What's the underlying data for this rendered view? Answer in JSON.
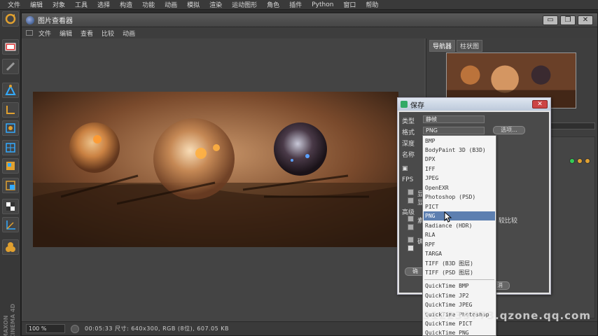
{
  "main_menu": [
    "文件",
    "编辑",
    "对象",
    "工具",
    "选择",
    "构造",
    "功能",
    "动画",
    "模拟",
    "渲染",
    "运动图形",
    "角色",
    "插件",
    "Python",
    "窗口",
    "帮助"
  ],
  "viewer": {
    "title": "图片查看器",
    "menu": [
      "文件",
      "编辑",
      "查看",
      "比较",
      "动画"
    ],
    "nav_tabs": [
      "导航器",
      "柱状图"
    ],
    "zoom": "100 %",
    "status": "00:05:33  尺寸: 640x300, RGB (8位), 607.05 KB",
    "controls": {
      "minimize": "▭",
      "restore": "❐",
      "close": "✕"
    }
  },
  "save_dialog": {
    "title": "保存",
    "type_label": "类型",
    "type_value": "静帧",
    "format_label": "格式",
    "format_value": "PNG",
    "options_button": "选项...",
    "depth_label": "深度",
    "name_label": "名称",
    "fps_label": "FPS",
    "advanced_label": "高级",
    "compare_label": "较比较",
    "partial_labels": [
      "显",
      "显",
      "素",
      "确",
      "消"
    ],
    "close": "✕"
  },
  "format_dropdown": {
    "items": [
      "BMP",
      "BodyPaint 3D (B3D)",
      "DPX",
      "IFF",
      "JPEG",
      "OpenEXR",
      "Photoshop (PSD)",
      "PICT",
      "PNG",
      "Radiance (HDR)",
      "RLA",
      "RPF",
      "TARGA",
      "TIFF (B3D 图层)",
      "TIFF (PSD 图层)"
    ],
    "quicktime_items": [
      "QuickTime BMP",
      "QuickTime JP2",
      "QuickTime JPEG",
      "QuickTime Photoshop",
      "QuickTime PICT",
      "QuickTime PNG"
    ],
    "selected": "PNG"
  },
  "cinema_logo": [
    "MAXON",
    "CINEMA 4D"
  ],
  "watermark": "312239773.qzone.qq.com",
  "colors": {
    "accent_selected": "#5d7fb0",
    "close_red": "#c44444",
    "dot_green": "#33cc55",
    "dot_orange": "#e0a030"
  }
}
